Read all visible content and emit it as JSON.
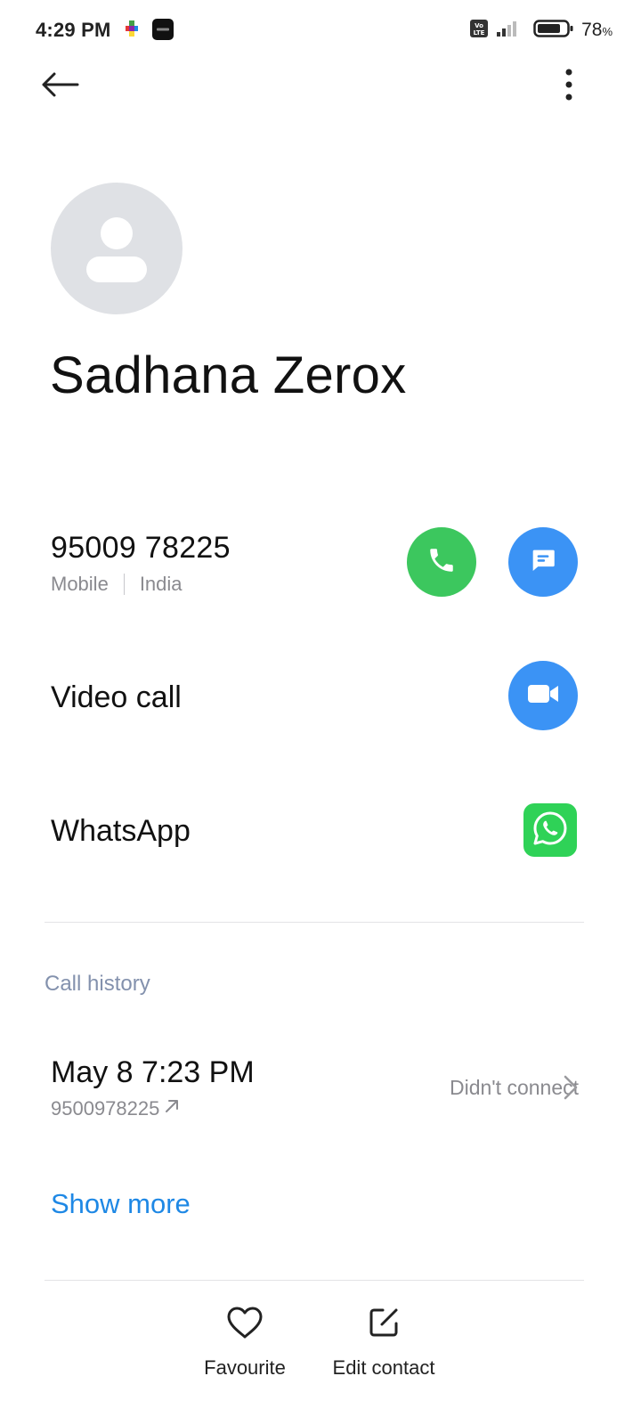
{
  "status_bar": {
    "time": "4:29 PM",
    "network_label": "Vo LTE",
    "battery_percent": "78",
    "battery_unit": "%",
    "battery_level": 0.78
  },
  "top_bar": {
    "back_icon": "arrow-left-icon",
    "more_icon": "more-vertical-icon"
  },
  "contact": {
    "name": "Sadhana Zerox",
    "avatar_icon": "person-placeholder-icon"
  },
  "phone": {
    "number": "95009 78225",
    "type": "Mobile",
    "region": "India",
    "call_icon": "phone-icon",
    "message_icon": "message-icon",
    "call_color": "#3cc75e",
    "message_color": "#3b93f5"
  },
  "video_call": {
    "label": "Video call",
    "icon": "video-camera-icon"
  },
  "whatsapp": {
    "label": "WhatsApp",
    "icon": "whatsapp-icon",
    "color": "#2fd257"
  },
  "call_history": {
    "title": "Call history",
    "entries": [
      {
        "datetime": "May 8 7:23 PM",
        "number": "9500978225",
        "direction_icon": "outgoing-arrow-icon",
        "status": "Didn't connect"
      }
    ],
    "show_more": "Show more"
  },
  "bottom_actions": {
    "favourite": "Favourite",
    "edit_contact": "Edit contact"
  }
}
